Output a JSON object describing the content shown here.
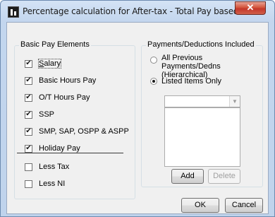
{
  "window": {
    "title": "Percentage calculation for After-tax - Total Pay based on...",
    "close_glyph": "✕"
  },
  "basic_pay": {
    "label": "Basic Pay Elements",
    "items": [
      {
        "label": "Salary",
        "checked": true,
        "check_glyph": "✔"
      },
      {
        "label": "Basic Hours Pay",
        "checked": true,
        "check_glyph": "✔"
      },
      {
        "label": "O/T Hours Pay",
        "checked": true,
        "check_glyph": "✔"
      },
      {
        "label": "SSP",
        "checked": true,
        "check_glyph": "✔"
      },
      {
        "label": "SMP, SAP, OSPP & ASPP",
        "checked": true,
        "check_glyph": "✔"
      },
      {
        "label": "Holiday Pay",
        "checked": true,
        "check_glyph": "✔"
      },
      {
        "label": "Less Tax",
        "checked": false,
        "check_glyph": ""
      },
      {
        "label": "Less NI",
        "checked": false,
        "check_glyph": ""
      }
    ]
  },
  "payments": {
    "label": "Payments/Deductions Included",
    "options": [
      {
        "label_line1": "All Previous Payments/Dedns",
        "label_line2": "(Hierarchical)",
        "selected": false
      },
      {
        "label_line1": "Listed Items Only",
        "label_line2": "",
        "selected": true
      }
    ],
    "combo_value": "",
    "combo_arrow_glyph": "▼",
    "list_items": [],
    "add_label": "Add",
    "delete_label": "Delete"
  },
  "footer": {
    "ok_label": "OK",
    "cancel_label": "Cancel"
  }
}
